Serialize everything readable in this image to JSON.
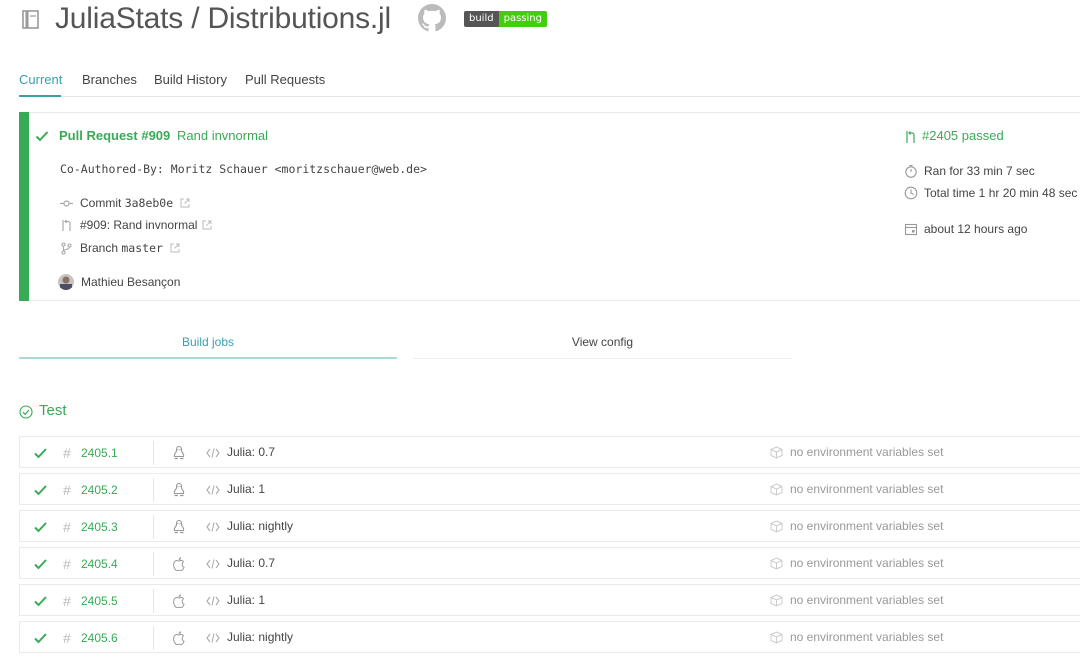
{
  "header": {
    "repo_title": "JuliaStats / Distributions.jl",
    "badge": {
      "left": "build",
      "right": "passing"
    }
  },
  "tabs": [
    {
      "label": "Current",
      "active": true
    },
    {
      "label": "Branches",
      "active": false
    },
    {
      "label": "Build History",
      "active": false
    },
    {
      "label": "Pull Requests",
      "active": false
    }
  ],
  "build": {
    "status_color": "#39aa56",
    "pr_number": "Pull Request #909",
    "pr_title": "Rand invnormal",
    "commit_message": "Co-Authored-By: Moritz Schauer <moritzschauer@web.de>",
    "commit_label": "Commit",
    "commit_sha": "3a8eb0e",
    "pr_link": "#909: Rand invnormal",
    "branch_label": "Branch",
    "branch_name": "master",
    "author": "Mathieu Besançon",
    "build_number": "#2405 passed",
    "ran_for": "Ran for 33 min 7 sec",
    "total_time": "Total time 1 hr 20 min 48 sec",
    "finished": "about 12 hours ago"
  },
  "subtabs": {
    "jobs": "Build jobs",
    "config": "View config"
  },
  "stage": {
    "title": "Test"
  },
  "jobs": [
    {
      "number": "2405.1",
      "os": "linux-icon",
      "language": "Julia: 0.7",
      "env": "no environment variables set"
    },
    {
      "number": "2405.2",
      "os": "linux-icon",
      "language": "Julia: 1",
      "env": "no environment variables set"
    },
    {
      "number": "2405.3",
      "os": "linux-icon",
      "language": "Julia: nightly",
      "env": "no environment variables set"
    },
    {
      "number": "2405.4",
      "os": "apple-icon",
      "language": "Julia: 0.7",
      "env": "no environment variables set"
    },
    {
      "number": "2405.5",
      "os": "apple-icon",
      "language": "Julia: 1",
      "env": "no environment variables set"
    },
    {
      "number": "2405.6",
      "os": "apple-icon",
      "language": "Julia: nightly",
      "env": "no environment variables set"
    }
  ]
}
